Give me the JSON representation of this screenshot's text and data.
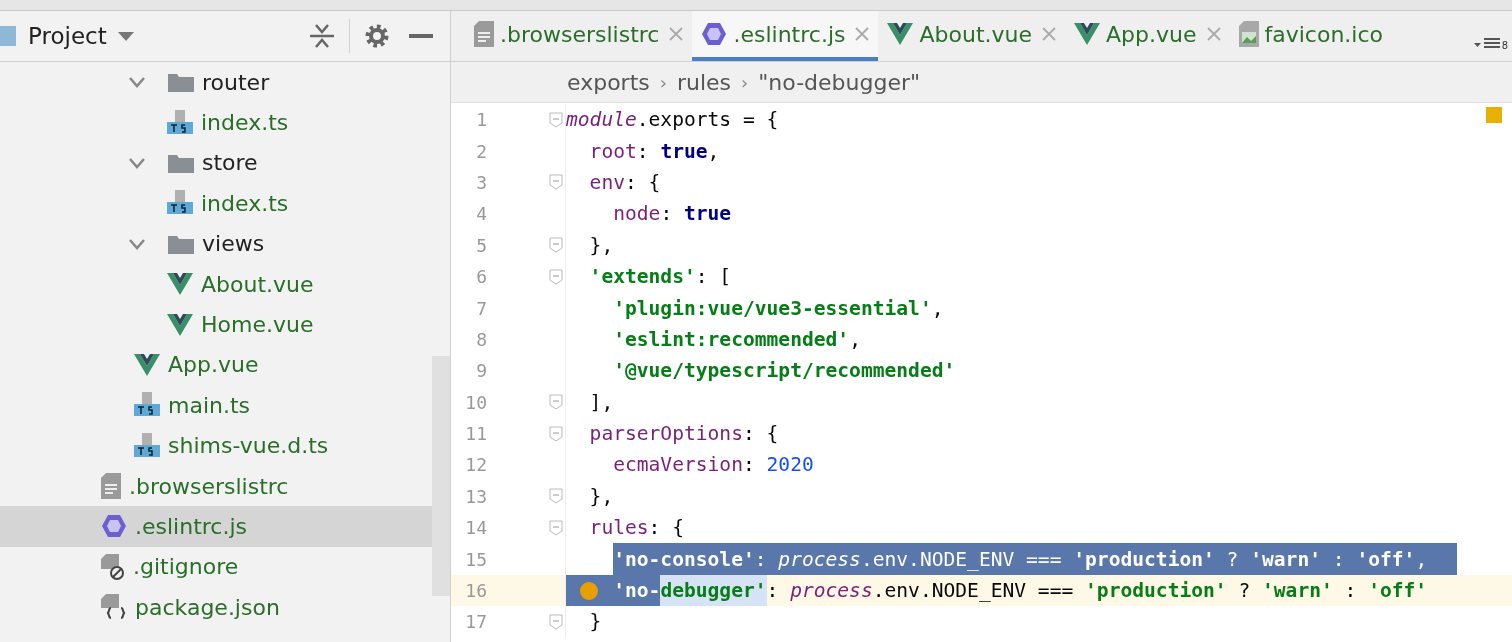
{
  "panel": {
    "title": "Project"
  },
  "tree": [
    {
      "children": [
        {
          "name": "router",
          "kind": "folder",
          "expanded": true,
          "children": [
            {
              "name": "index.ts",
              "kind": "ts",
              "selected": false
            }
          ],
          "selected": false
        },
        {
          "name": "store",
          "kind": "folder",
          "expanded": true,
          "children": [
            {
              "name": "index.ts",
              "kind": "ts",
              "selected": false
            }
          ],
          "selected": false
        },
        {
          "name": "views",
          "kind": "folder",
          "expanded": true,
          "children": [
            {
              "name": "About.vue",
              "kind": "vue",
              "selected": false
            },
            {
              "name": "Home.vue",
              "kind": "vue",
              "selected": false
            }
          ],
          "selected": false
        },
        {
          "name": "App.vue",
          "kind": "vue",
          "selected": false
        },
        {
          "name": "main.ts",
          "kind": "ts",
          "selected": false
        },
        {
          "name": "shims-vue.d.ts",
          "kind": "ts",
          "selected": false
        }
      ]
    },
    {
      "name": ".browserslistrc",
      "kind": "text",
      "selected": false
    },
    {
      "name": ".eslintrc.js",
      "kind": "eslint",
      "selected": true
    },
    {
      "name": ".gitignore",
      "kind": "gitignore",
      "selected": false
    },
    {
      "name": "package.json",
      "kind": "json",
      "selected": false
    }
  ],
  "tabs": [
    {
      "label": ".browserslistrc",
      "kind": "text",
      "selected": false,
      "closable": true
    },
    {
      "label": ".eslintrc.js",
      "kind": "eslint",
      "selected": true,
      "closable": true
    },
    {
      "label": "About.vue",
      "kind": "vue",
      "selected": false,
      "closable": true
    },
    {
      "label": "App.vue",
      "kind": "vue",
      "selected": false,
      "closable": true
    },
    {
      "label": "favicon.ico",
      "kind": "image",
      "selected": false,
      "closable": false
    }
  ],
  "tab_count": "8",
  "breadcrumb": [
    {
      "kind": "item",
      "text": "exports"
    },
    {
      "kind": "separator",
      "text": "›"
    },
    {
      "kind": "item",
      "text": "rules"
    },
    {
      "kind": "separator",
      "text": "›"
    },
    {
      "kind": "item",
      "text": "\"no-debugger\""
    }
  ],
  "lines": [
    {
      "num": "1",
      "fold": true,
      "tokens": [
        {
          "text": "module",
          "kind": "italic"
        },
        {
          "text": ".exports = {",
          "kind": "plain"
        }
      ]
    },
    {
      "num": "2",
      "fold": false,
      "tokens": [
        {
          "text": "  root",
          "kind": "prop"
        },
        {
          "text": ": ",
          "kind": "plain"
        },
        {
          "text": "true",
          "kind": "bool"
        },
        {
          "text": ",",
          "kind": "plain"
        }
      ]
    },
    {
      "num": "3",
      "fold": true,
      "tokens": [
        {
          "text": "  env",
          "kind": "prop"
        },
        {
          "text": ": {",
          "kind": "plain"
        }
      ]
    },
    {
      "num": "4",
      "fold": false,
      "tokens": [
        {
          "text": "    node",
          "kind": "prop"
        },
        {
          "text": ": ",
          "kind": "plain"
        },
        {
          "text": "true",
          "kind": "bool"
        }
      ]
    },
    {
      "num": "5",
      "fold": true,
      "tokens": [
        {
          "text": "  },",
          "kind": "plain"
        }
      ]
    },
    {
      "num": "6",
      "fold": true,
      "tokens": [
        {
          "text": "  'extends'",
          "kind": "str"
        },
        {
          "text": ": [",
          "kind": "plain"
        }
      ]
    },
    {
      "num": "7",
      "fold": false,
      "tokens": [
        {
          "text": "    'plugin:vue/vue3-essential'",
          "kind": "str"
        },
        {
          "text": ",",
          "kind": "plain"
        }
      ]
    },
    {
      "num": "8",
      "fold": false,
      "tokens": [
        {
          "text": "    'eslint:recommended'",
          "kind": "str"
        },
        {
          "text": ",",
          "kind": "plain"
        }
      ]
    },
    {
      "num": "9",
      "fold": false,
      "tokens": [
        {
          "text": "    '@vue/typescript/recommended'",
          "kind": "str"
        }
      ]
    },
    {
      "num": "10",
      "fold": true,
      "tokens": [
        {
          "text": "  ],",
          "kind": "plain"
        }
      ]
    },
    {
      "num": "11",
      "fold": true,
      "tokens": [
        {
          "text": "  parserOptions",
          "kind": "prop"
        },
        {
          "text": ": {",
          "kind": "plain"
        }
      ]
    },
    {
      "num": "12",
      "fold": false,
      "tokens": [
        {
          "text": "    ecmaVersion",
          "kind": "prop"
        },
        {
          "text": ": ",
          "kind": "plain"
        },
        {
          "text": "2020",
          "kind": "num"
        }
      ]
    },
    {
      "num": "13",
      "fold": true,
      "tokens": [
        {
          "text": "  },",
          "kind": "plain"
        }
      ]
    },
    {
      "num": "14",
      "fold": true,
      "tokens": [
        {
          "text": "  rules",
          "kind": "prop"
        },
        {
          "text": ": {",
          "kind": "plain"
        }
      ]
    },
    {
      "num": "15",
      "fold": false,
      "selected": true,
      "tokens": [
        {
          "text": "    'no-console'",
          "kind": "str"
        },
        {
          "text": ": ",
          "kind": "plain"
        },
        {
          "text": "process",
          "kind": "italic"
        },
        {
          "text": ".env.NODE_ENV === ",
          "kind": "plain"
        },
        {
          "text": "'production'",
          "kind": "str"
        },
        {
          "text": " ? ",
          "kind": "plain"
        },
        {
          "text": "'warn'",
          "kind": "str"
        },
        {
          "text": " : ",
          "kind": "plain"
        },
        {
          "text": "'off'",
          "kind": "str"
        },
        {
          "text": ",",
          "kind": "plain"
        }
      ]
    },
    {
      "num": "16",
      "fold": false,
      "current": true,
      "bulb": true,
      "tokens": [
        {
          "text": "    'no-",
          "kind": "str",
          "selected": true
        },
        {
          "text": "debugger'",
          "kind": "str",
          "highlight": true
        },
        {
          "text": ": ",
          "kind": "plain"
        },
        {
          "text": "process",
          "kind": "italic"
        },
        {
          "text": ".env.NODE_ENV === ",
          "kind": "plain"
        },
        {
          "text": "'production'",
          "kind": "str"
        },
        {
          "text": " ? ",
          "kind": "plain"
        },
        {
          "text": "'warn'",
          "kind": "str"
        },
        {
          "text": " : ",
          "kind": "plain"
        },
        {
          "text": "'off'",
          "kind": "str"
        }
      ]
    },
    {
      "num": "17",
      "fold": true,
      "tokens": [
        {
          "text": "  }",
          "kind": "plain"
        }
      ]
    }
  ]
}
